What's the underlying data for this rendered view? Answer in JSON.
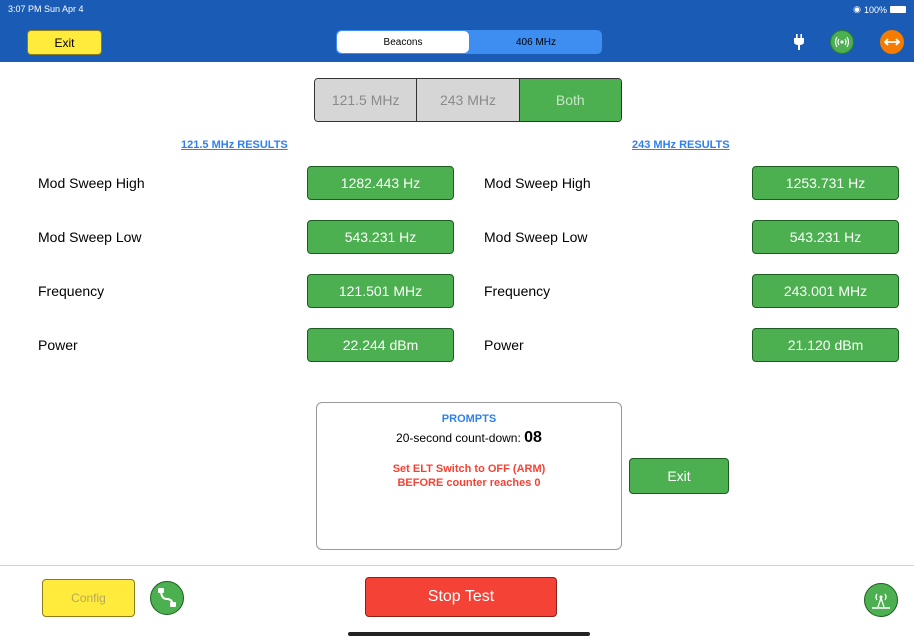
{
  "status": {
    "time": "3:07 PM  Sun Apr 4",
    "battery": "100%"
  },
  "header": {
    "exit_label": "Exit",
    "tabs": [
      {
        "label": "Beacons",
        "active": true
      },
      {
        "label": "406 MHz",
        "active": false
      }
    ],
    "icons": [
      "plug-icon",
      "radio-icon",
      "arrows-icon"
    ]
  },
  "band": {
    "options": [
      {
        "label": "121.5 MHz",
        "active": false
      },
      {
        "label": "243 MHz",
        "active": false
      },
      {
        "label": "Both",
        "active": true
      }
    ]
  },
  "results": {
    "left": {
      "title": "121.5 MHz  RESULTS",
      "rows": [
        {
          "label": "Mod Sweep High",
          "value": "1282.443 Hz"
        },
        {
          "label": "Mod Sweep Low",
          "value": "543.231 Hz"
        },
        {
          "label": "Frequency",
          "value": "121.501 MHz"
        },
        {
          "label": "Power",
          "value": "22.244 dBm"
        }
      ]
    },
    "right": {
      "title": "243 MHz  RESULTS",
      "rows": [
        {
          "label": "Mod Sweep High",
          "value": "1253.731 Hz"
        },
        {
          "label": "Mod Sweep Low",
          "value": "543.231 Hz"
        },
        {
          "label": "Frequency",
          "value": "243.001 MHz"
        },
        {
          "label": "Power",
          "value": "21.120 dBm"
        }
      ]
    }
  },
  "prompts": {
    "title": "PROMPTS",
    "countdown_label": "20-second count-down: ",
    "countdown_value": "08",
    "warning_line1": "Set ELT Switch to OFF (ARM)",
    "warning_line2": "BEFORE counter reaches 0"
  },
  "exit_button": "Exit",
  "bottom": {
    "config_label": "Config",
    "stop_label": "Stop Test"
  },
  "colors": {
    "bar": "#1a5cb5",
    "green": "#4caf50",
    "yellow": "#ffeb3b",
    "red": "#f44336",
    "link": "#2f80ed"
  }
}
